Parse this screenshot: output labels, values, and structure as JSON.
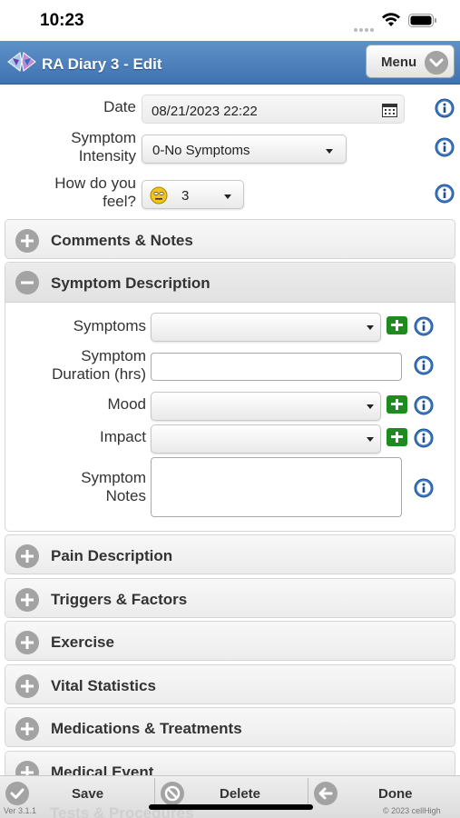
{
  "status_bar": {
    "time": "10:23"
  },
  "header": {
    "title": "RA Diary 3 - Edit",
    "menu_label": "Menu",
    "accent": "#4a7fbd"
  },
  "form": {
    "date_label": "Date",
    "date_value": "08/21/2023 22:22",
    "intensity_label_line1": "Symptom",
    "intensity_label_line2": "Intensity",
    "intensity_value": "0-No Symptoms",
    "feel_label_line1": "How do you",
    "feel_label_line2": "feel?",
    "feel_value": "3"
  },
  "sections_top": [
    {
      "title": "Comments & Notes",
      "icon": "plus-circle-icon"
    }
  ],
  "symptom_panel": {
    "title": "Symptom Description",
    "icon": "minus-circle-icon",
    "symptoms_label": "Symptoms",
    "duration_label_line1": "Symptom",
    "duration_label_line2": "Duration (hrs)",
    "mood_label": "Mood",
    "impact_label": "Impact",
    "notes_label_line1": "Symptom",
    "notes_label_line2": "Notes",
    "symptoms_value": "",
    "duration_value": "",
    "mood_value": "",
    "impact_value": "",
    "notes_value": ""
  },
  "sections_bottom": [
    {
      "title": "Pain Description",
      "icon": "plus-circle-icon"
    },
    {
      "title": "Triggers & Factors",
      "icon": "plus-circle-icon"
    },
    {
      "title": "Exercise",
      "icon": "plus-circle-icon"
    },
    {
      "title": "Vital Statistics",
      "icon": "plus-circle-icon"
    },
    {
      "title": "Medications & Treatments",
      "icon": "plus-circle-icon"
    },
    {
      "title": "Medical Event",
      "icon": "plus-circle-icon"
    }
  ],
  "peek_section": "Tests & Procedures",
  "toolbar": {
    "save_label": "Save",
    "delete_label": "Delete",
    "done_label": "Done"
  },
  "footer": {
    "version": "Ver 3.1.1",
    "copyright": "© 2023 cellHigh"
  }
}
